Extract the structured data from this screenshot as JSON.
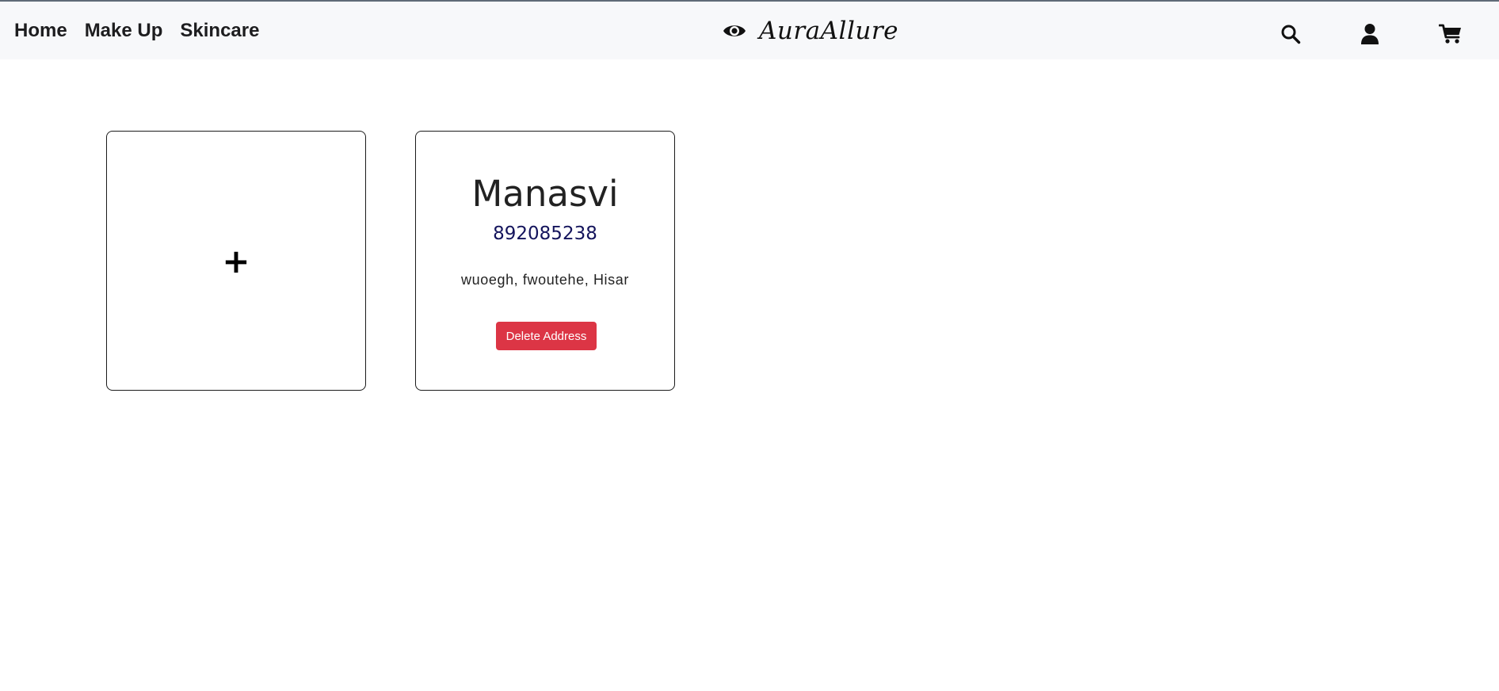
{
  "nav": {
    "links": [
      "Home",
      "Make Up",
      "Skincare"
    ],
    "brand_name": "AuraAllure",
    "brand_icon": "eye-icon",
    "right_icons": [
      "search-icon",
      "user-icon",
      "cart-icon"
    ]
  },
  "addresses": {
    "add_label": "+",
    "items": [
      {
        "name": "Manasvi",
        "phone": "892085238",
        "address": "wuoegh, fwoutehe, Hisar",
        "delete_label": "Delete Address"
      }
    ]
  },
  "colors": {
    "delete_button": "#dc3545",
    "phone_text": "#14145c",
    "navbar_bg": "#f7f8fa"
  }
}
